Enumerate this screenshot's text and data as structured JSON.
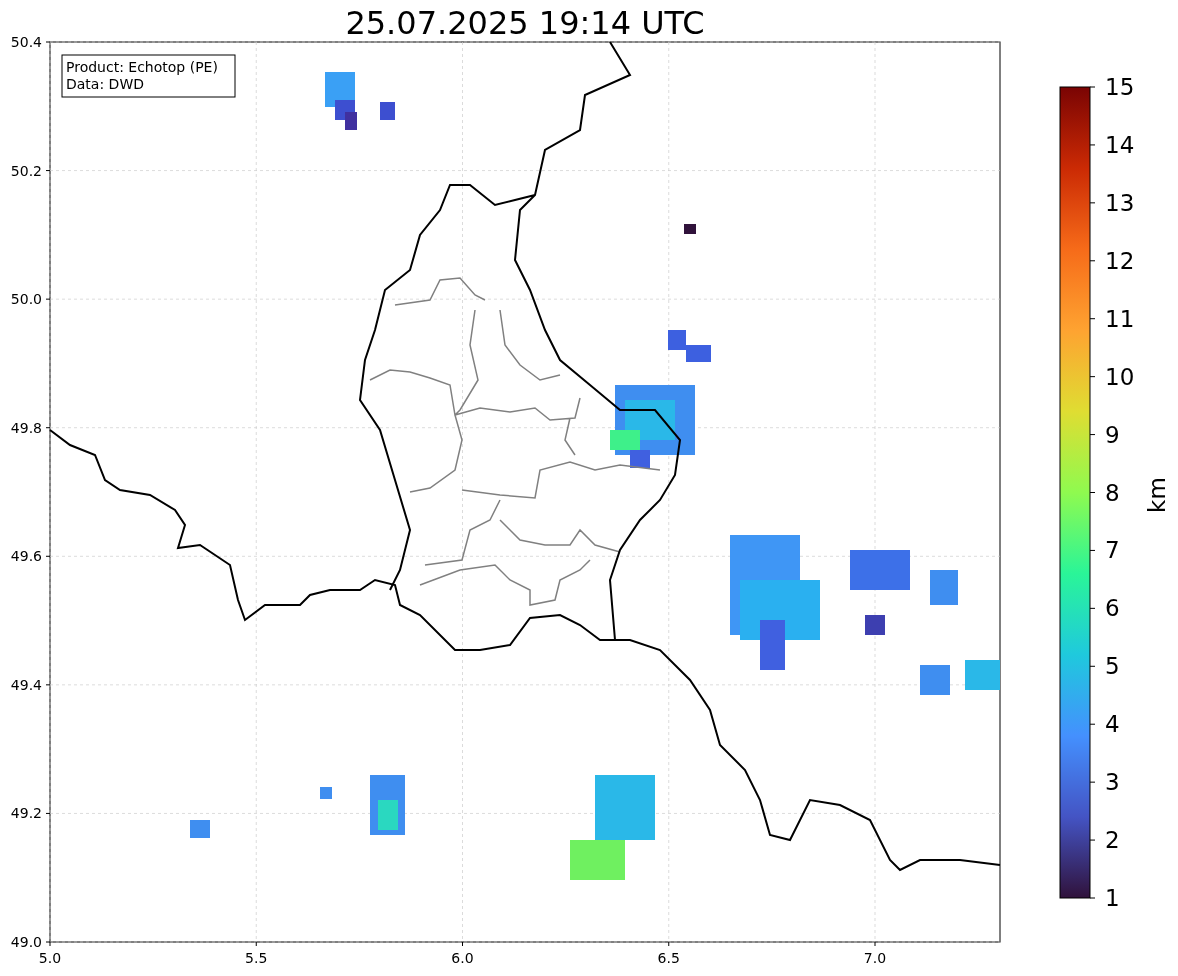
{
  "title": "25.07.2025 19:14 UTC",
  "info_box": [
    "Product: Echotop (PE)",
    "Data: DWD"
  ],
  "x_ticks": [
    "5.0",
    "5.5",
    "6.0",
    "6.5",
    "7.0"
  ],
  "y_ticks": [
    "50.4",
    "50.2",
    "50.0",
    "49.8",
    "49.6",
    "49.4",
    "49.2",
    "49.0"
  ],
  "colorbar": {
    "label": "km",
    "ticks": [
      "15",
      "14",
      "13",
      "12",
      "11",
      "10",
      "9",
      "8",
      "7",
      "6",
      "5",
      "4",
      "3",
      "2",
      "1"
    ]
  }
}
